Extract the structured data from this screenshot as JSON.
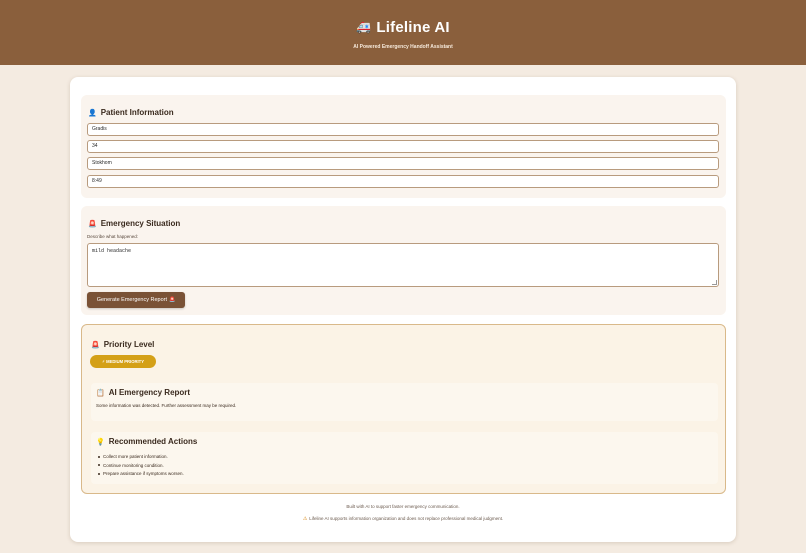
{
  "header": {
    "title": "Lifeline AI",
    "subtitle": "AI Powered Emergency Handoff Assistant"
  },
  "patient": {
    "title": "Patient Information",
    "name_value": "Gradis",
    "age_value": "34",
    "location_value": "Stokhom",
    "time_value": "8:49"
  },
  "emergency": {
    "title": "Emergency Situation",
    "hint": "Describe what happened:",
    "description_value": "mild headache",
    "generate_label": "Generate Emergency Report"
  },
  "priority": {
    "title": "Priority Level",
    "badge": "MEDIUM PRIORITY",
    "badge_color": "#d4a017"
  },
  "report": {
    "title": "AI Emergency Report",
    "text": "Some information was detected. Further assessment may be required."
  },
  "actions": {
    "title": "Recommended Actions",
    "items": [
      "Collect more patient information.",
      "Continue monitoring condition.",
      "Prepare assistance if symptoms worsen."
    ]
  },
  "footer": {
    "line1": "Built with AI to support faster emergency communication.",
    "line2": "Lifeline AI supports information organization and does not replace professional medical judgment."
  },
  "colors": {
    "header_bg": "#8a5f3c",
    "button_bg": "#7a5236",
    "page_bg": "#f4ebe1"
  }
}
